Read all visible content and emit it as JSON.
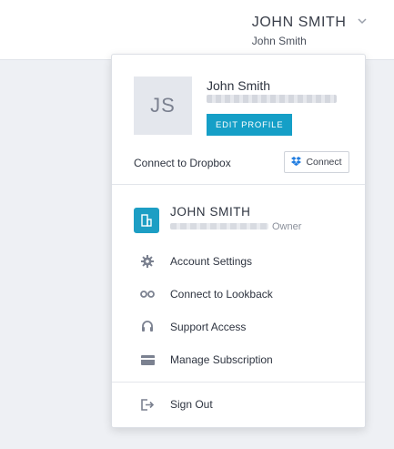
{
  "header": {
    "account_name_upper": "JOHN SMITH",
    "account_name": "John Smith"
  },
  "profile": {
    "initials": "JS",
    "name": "John Smith",
    "edit_label": "EDIT PROFILE"
  },
  "dropbox": {
    "label": "Connect to Dropbox",
    "connect_label": "Connect"
  },
  "organization": {
    "name": "JOHN SMITH",
    "role": "Owner"
  },
  "menu": [
    {
      "label": "Account Settings",
      "icon": "gear-icon"
    },
    {
      "label": "Connect to Lookback",
      "icon": "link-icon"
    },
    {
      "label": "Support Access",
      "icon": "headset-icon"
    },
    {
      "label": "Manage Subscription",
      "icon": "credit-card-icon"
    }
  ],
  "sign_out": {
    "label": "Sign Out",
    "icon": "sign-out-icon"
  },
  "colors": {
    "accent": "#159fc7",
    "background": "#eef0f4"
  }
}
